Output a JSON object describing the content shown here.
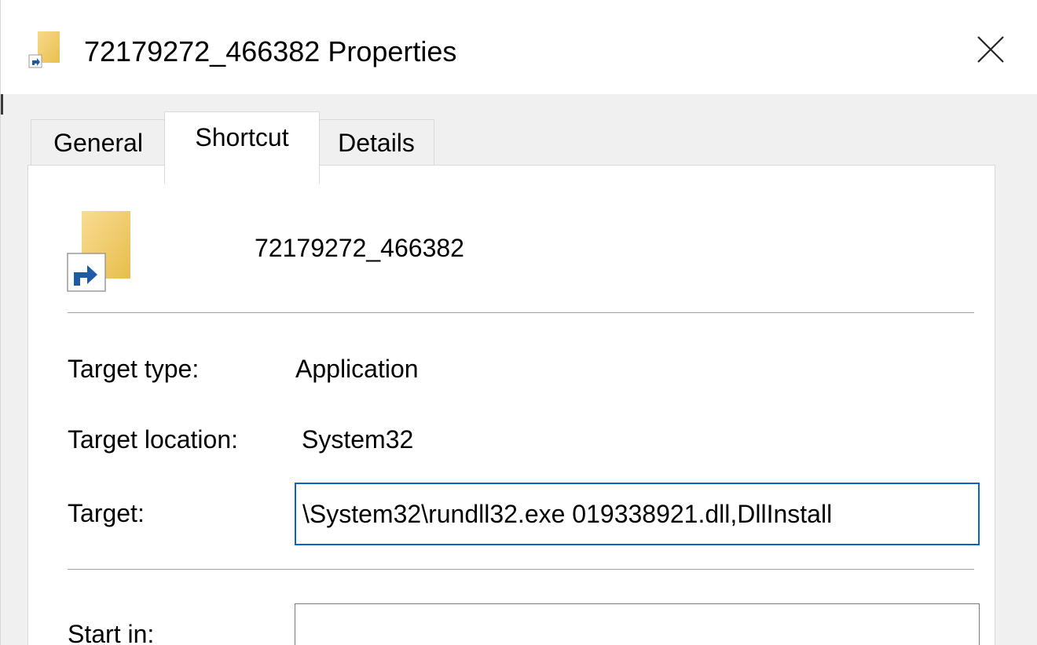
{
  "window": {
    "title": "72179272_466382 Properties",
    "title_icon": "folder-shortcut-icon",
    "close_icon": "close-icon"
  },
  "tabs": [
    {
      "label": "General",
      "active": false
    },
    {
      "label": "Shortcut",
      "active": true
    },
    {
      "label": "Details",
      "active": false
    }
  ],
  "shortcut": {
    "icon": "folder-shortcut-icon",
    "name": "72179272_466382",
    "target_type_label": "Target type:",
    "target_type_value": "Application",
    "target_location_label": "Target location:",
    "target_location_value": "System32",
    "target_label": "Target:",
    "target_value": "\\System32\\rundll32.exe 019338921.dll,DllInstall",
    "start_in_label": "Start in:",
    "start_in_value": ""
  },
  "colors": {
    "focus_border": "#0a64c8",
    "folder_yellow": "#f5d26e",
    "shortcut_arrow": "#1e5aa8"
  }
}
